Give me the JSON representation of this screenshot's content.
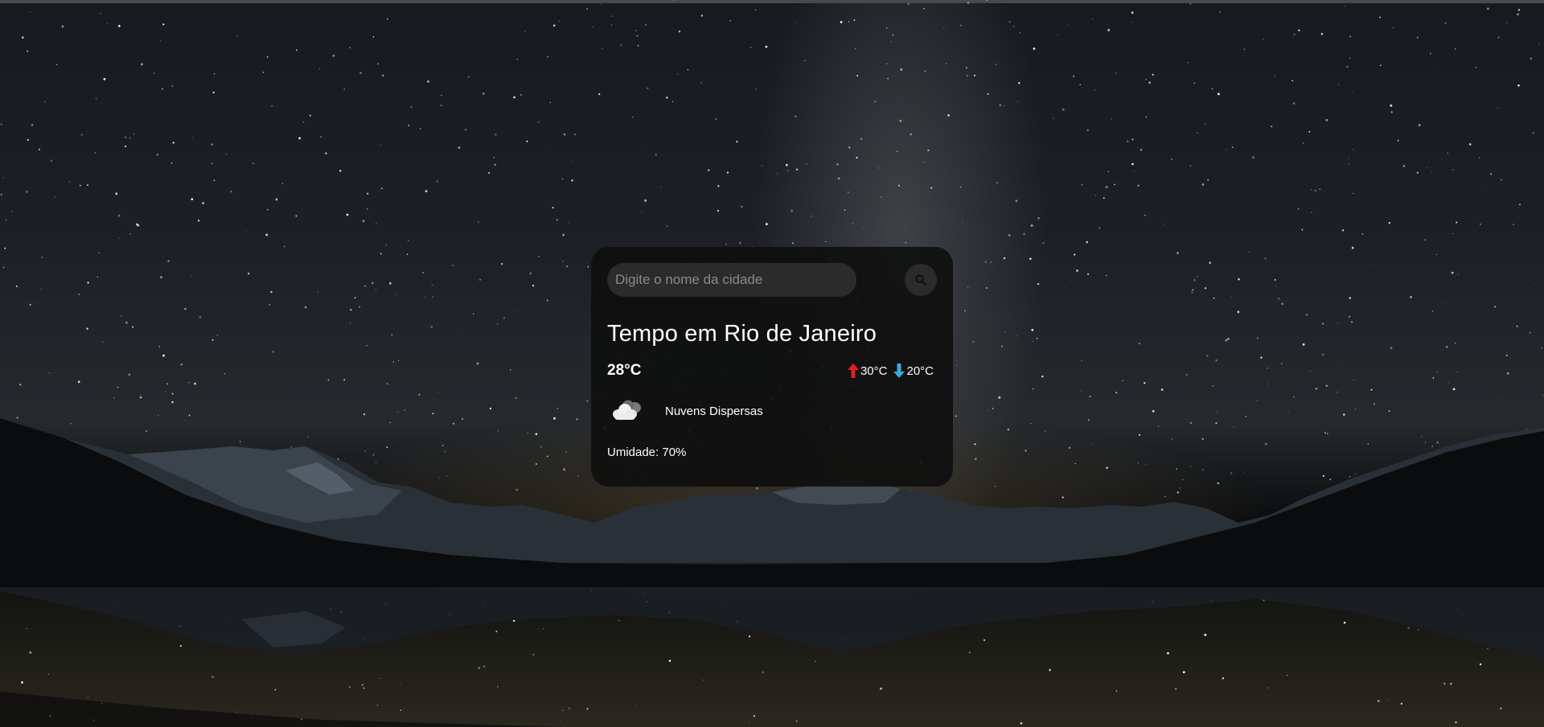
{
  "search": {
    "placeholder": "Digite o nome da cidade",
    "value": ""
  },
  "weather": {
    "title": "Tempo em Rio de Janeiro",
    "temperature": "28°C",
    "max": "30°C",
    "min": "20°C",
    "description": "Nuvens Dispersas",
    "humidity": "Umidade: 70%"
  },
  "icons": {
    "search": "search-icon",
    "max": "arrow-up-icon",
    "min": "arrow-down-icon",
    "condition": "cloud-icon"
  },
  "colors": {
    "card_background": "#0f0f0f",
    "input_background": "#2b2b2b",
    "max_arrow": "#e02020",
    "min_arrow": "#3aaad8"
  }
}
